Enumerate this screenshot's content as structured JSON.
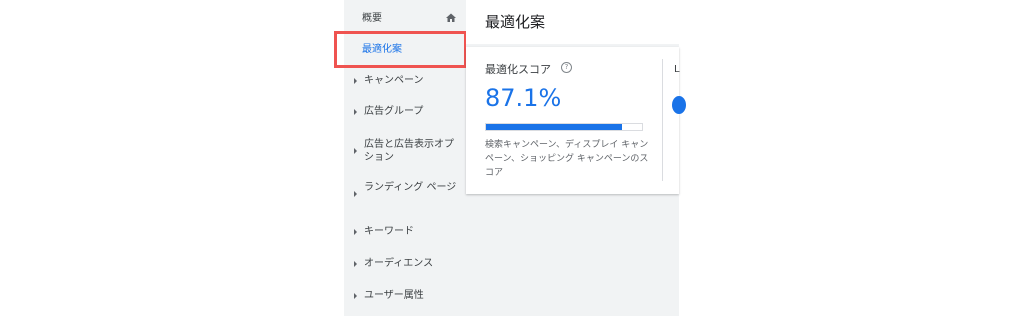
{
  "sidebar": {
    "overview": "概要",
    "active": "最適化案",
    "items": [
      {
        "label": "キャンペーン"
      },
      {
        "label": "広告グループ"
      },
      {
        "label": "広告と広告表示オプション"
      },
      {
        "label": "ランディング ページ"
      },
      {
        "label": "キーワード"
      },
      {
        "label": "オーディエンス"
      },
      {
        "label": "ユーザー属性"
      }
    ]
  },
  "header": {
    "title": "最適化案"
  },
  "card": {
    "title": "最適化スコア",
    "help": "?",
    "score": "87.1%",
    "score_fraction": 0.871,
    "description": "検索キャンペーン、ディスプレイ キャンペーン、ショッピング キャンペーンのスコア",
    "cut_text": "L"
  },
  "colors": {
    "accent": "#1a73e8",
    "highlight": "#ef5350"
  }
}
